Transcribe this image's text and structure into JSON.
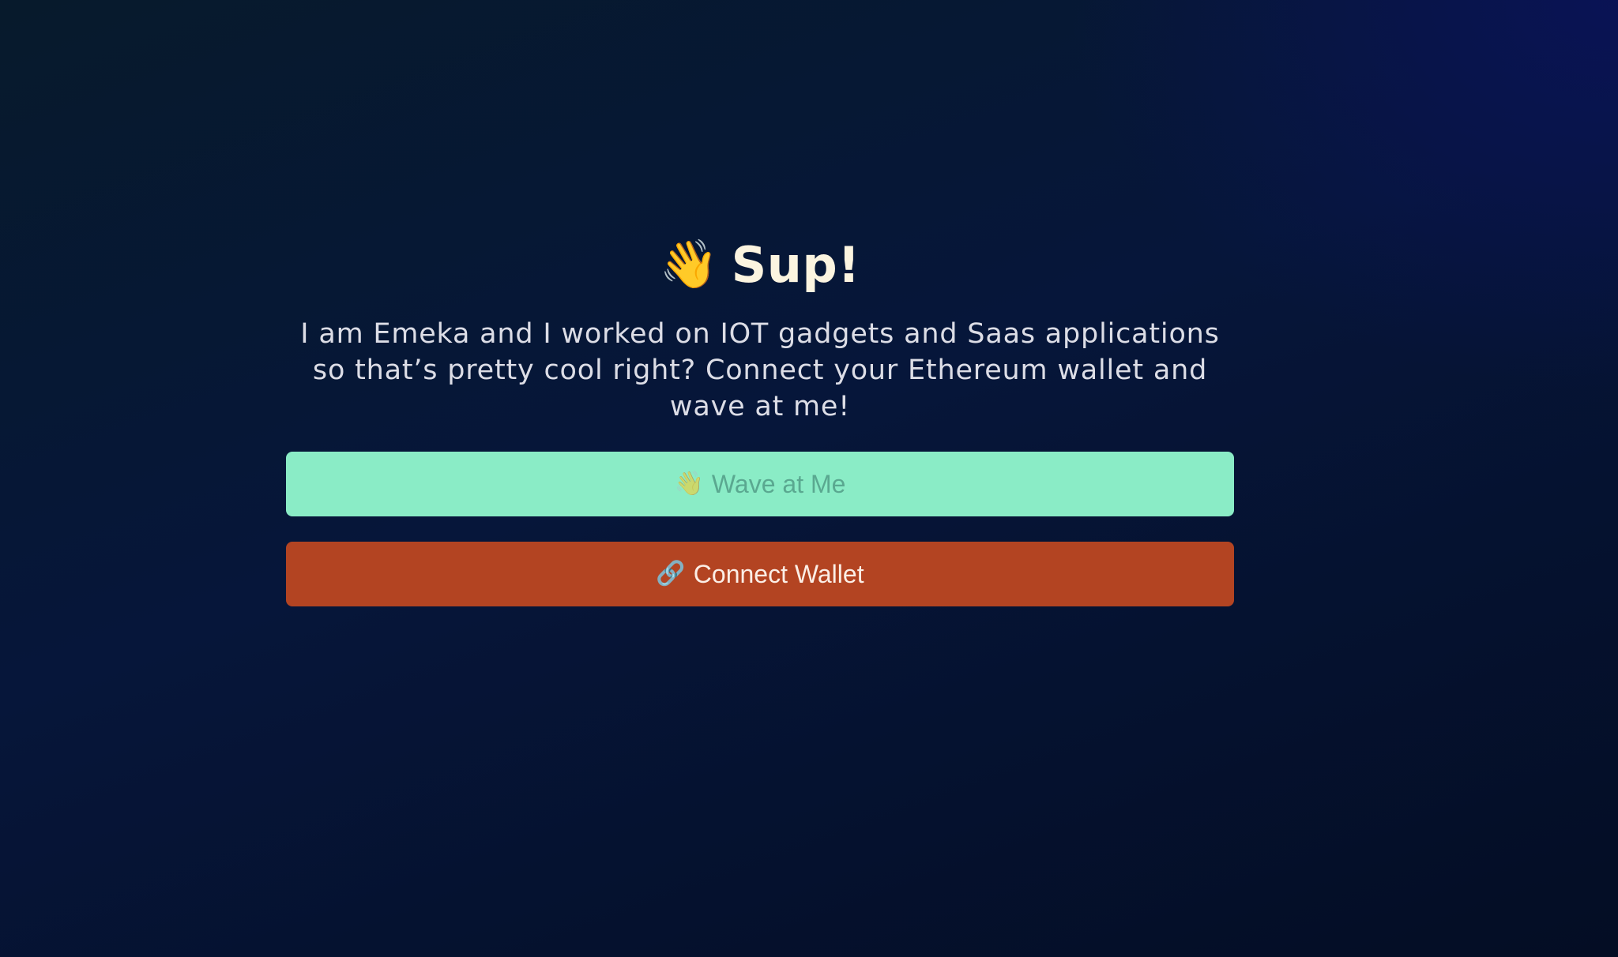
{
  "header": {
    "emoji_icon": "waving-hand-icon",
    "emoji": "👋",
    "title": "Sup!"
  },
  "bio": {
    "text": "I am Emeka and I worked on IOT gadgets and Saas applications so that’s pretty cool right? Connect your Ethereum wallet and wave at me!"
  },
  "buttons": {
    "wave": {
      "icon": "waving-hand-icon",
      "emoji": "👋",
      "label": "Wave at Me",
      "color": "#8aecc6"
    },
    "connect": {
      "icon": "link-icon",
      "emoji": "🔗",
      "label": "Connect Wallet",
      "color": "#b34422"
    }
  }
}
